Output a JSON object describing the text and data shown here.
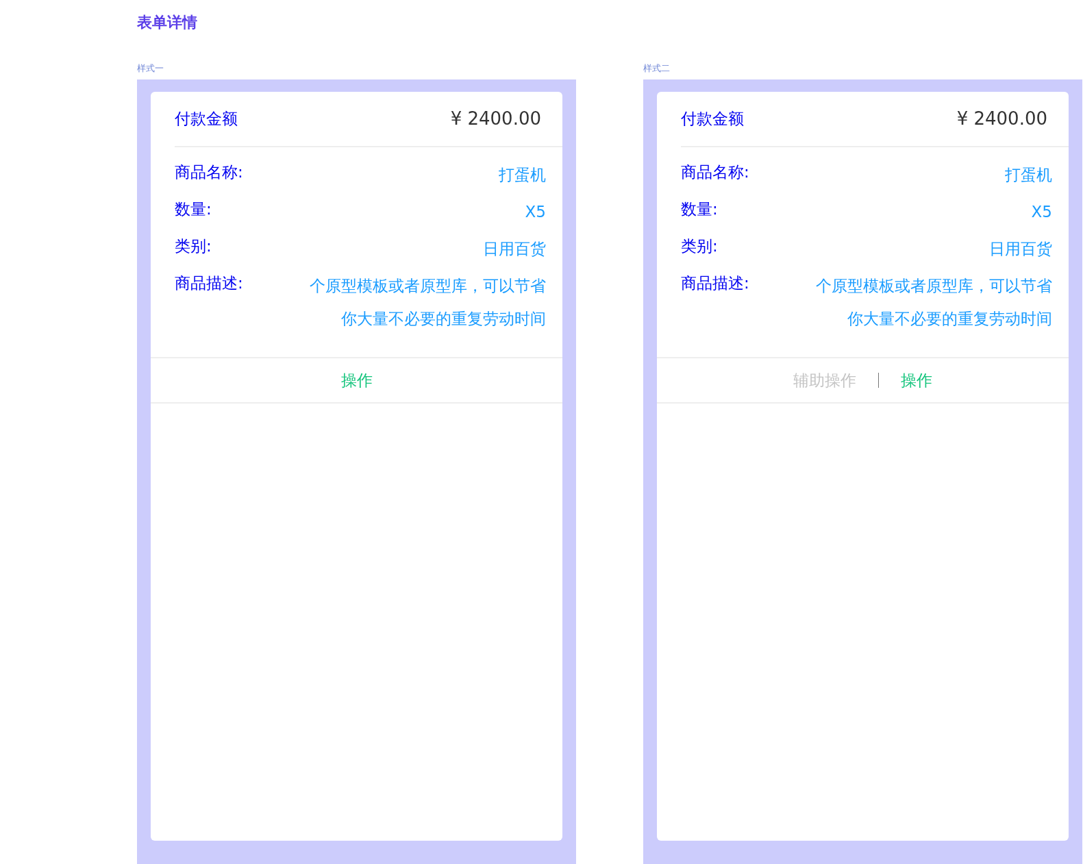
{
  "page_title": "表单详情",
  "styles": [
    {
      "caption": "样式一",
      "amount_label": "付款金额",
      "amount": "¥ 2400.00",
      "fields": [
        {
          "label": "商品名称:",
          "value": [
            "打蛋机"
          ]
        },
        {
          "label": "数量:",
          "value": [
            "X5"
          ]
        },
        {
          "label": "类别:",
          "value": [
            "日用百货"
          ]
        },
        {
          "label": "商品描述:",
          "value": [
            "个原型模板或者原型库，可以节省",
            "你大量不必要的重复劳动时间"
          ]
        }
      ],
      "actions": [
        {
          "label": "操作",
          "kind": "primary"
        }
      ]
    },
    {
      "caption": "样式二",
      "amount_label": "付款金额",
      "amount": "¥ 2400.00",
      "fields": [
        {
          "label": "商品名称:",
          "value": [
            "打蛋机"
          ]
        },
        {
          "label": "数量:",
          "value": [
            "X5"
          ]
        },
        {
          "label": "类别:",
          "value": [
            "日用百货"
          ]
        },
        {
          "label": "商品描述:",
          "value": [
            "个原型模板或者原型库，可以节省",
            "你大量不必要的重复劳动时间"
          ]
        }
      ],
      "actions": [
        {
          "label": "辅助操作",
          "kind": "secondary"
        },
        {
          "label": "操作",
          "kind": "primary"
        }
      ]
    }
  ]
}
